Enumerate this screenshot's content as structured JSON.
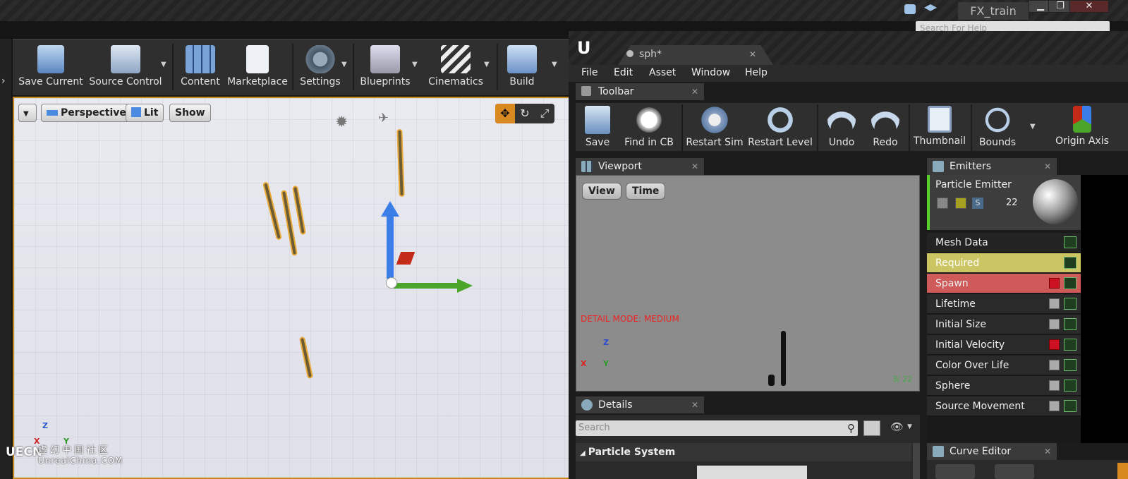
{
  "title_bar": {
    "project_tab": "FX_train",
    "help_search_placeholder": "Search For Help",
    "minimize": "▁",
    "maximize": "❐",
    "close": "✕"
  },
  "main_toolbar": {
    "buttons": [
      {
        "label": "Save Current"
      },
      {
        "label": "Source Control"
      },
      {
        "label": "Content"
      },
      {
        "label": "Marketplace"
      },
      {
        "label": "Settings"
      },
      {
        "label": "Blueprints"
      },
      {
        "label": "Cinematics"
      },
      {
        "label": "Build"
      }
    ]
  },
  "level_viewport": {
    "perspective": "Perspective",
    "lit": "Lit",
    "show": "Show",
    "axis_z": "Z",
    "axis_x": "X",
    "axis_y": "Y"
  },
  "watermark": {
    "logo": "UECN",
    "cn": "虚 幻 中 国 社 区",
    "url": "UnrealChina.COM"
  },
  "cascade": {
    "doc_tab": "sph*",
    "menus": [
      "File",
      "Edit",
      "Asset",
      "Window",
      "Help"
    ],
    "toolbar_tab": "Toolbar",
    "toolbar_buttons": [
      {
        "label": "Save"
      },
      {
        "label": "Find in CB"
      },
      {
        "label": "Restart Sim"
      },
      {
        "label": "Restart Level"
      },
      {
        "label": "Undo"
      },
      {
        "label": "Redo"
      },
      {
        "label": "Thumbnail"
      },
      {
        "label": "Bounds"
      },
      {
        "label": "Origin Axis"
      }
    ],
    "viewport_tab": "Viewport",
    "viewport_view": "View",
    "viewport_time": "Time",
    "detail_mode": "DETAIL MODE: MEDIUM",
    "vp_axis_z": "Z",
    "vp_axis_x": "X",
    "vp_axis_y": "Y",
    "vp_stats": "3/ 22",
    "emitters_tab": "Emitters",
    "emitter": {
      "name": "Particle Emitter",
      "count": "22",
      "solo": "S"
    },
    "modules": [
      {
        "label": "Mesh Data"
      },
      {
        "label": "Required"
      },
      {
        "label": "Spawn"
      },
      {
        "label": "Lifetime"
      },
      {
        "label": "Initial Size"
      },
      {
        "label": "Initial Velocity"
      },
      {
        "label": "Color Over Life"
      },
      {
        "label": "Sphere"
      },
      {
        "label": "Source Movement"
      }
    ],
    "details_tab": "Details",
    "details_search_placeholder": "Search",
    "details_section": "Particle System",
    "curve_editor_tab": "Curve Editor"
  }
}
